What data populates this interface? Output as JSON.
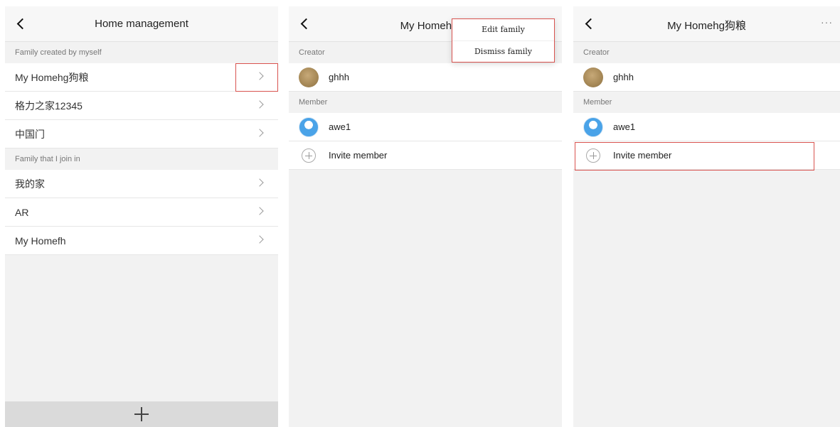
{
  "screen1": {
    "title": "Home management",
    "section_created": "Family created by myself",
    "created": [
      "My Homehg狗粮",
      "格力之家12345",
      "中国门"
    ],
    "section_joined": "Family that I join in",
    "joined": [
      "我的家",
      "AR",
      "My Homefh"
    ]
  },
  "screen2": {
    "title": "My Homehg狗粮",
    "section_creator": "Creator",
    "creator_name": "ghhh",
    "section_member": "Member",
    "member_name": "awe1",
    "invite_label": "Invite member",
    "menu": [
      "Edit family",
      "Dismiss family"
    ]
  },
  "screen3": {
    "title": "My Homehg狗粮",
    "more": "···",
    "section_creator": "Creator",
    "creator_name": "ghhh",
    "section_member": "Member",
    "member_name": "awe1",
    "invite_label": "Invite member"
  },
  "colors": {
    "highlight": "#d9534f",
    "background": "#f2f2f2",
    "row": "#ffffff"
  },
  "icons": [
    "back-arrow-icon",
    "chevron-right-icon",
    "plus-icon",
    "plus-circle-icon",
    "more-icon",
    "avatar-icon"
  ]
}
